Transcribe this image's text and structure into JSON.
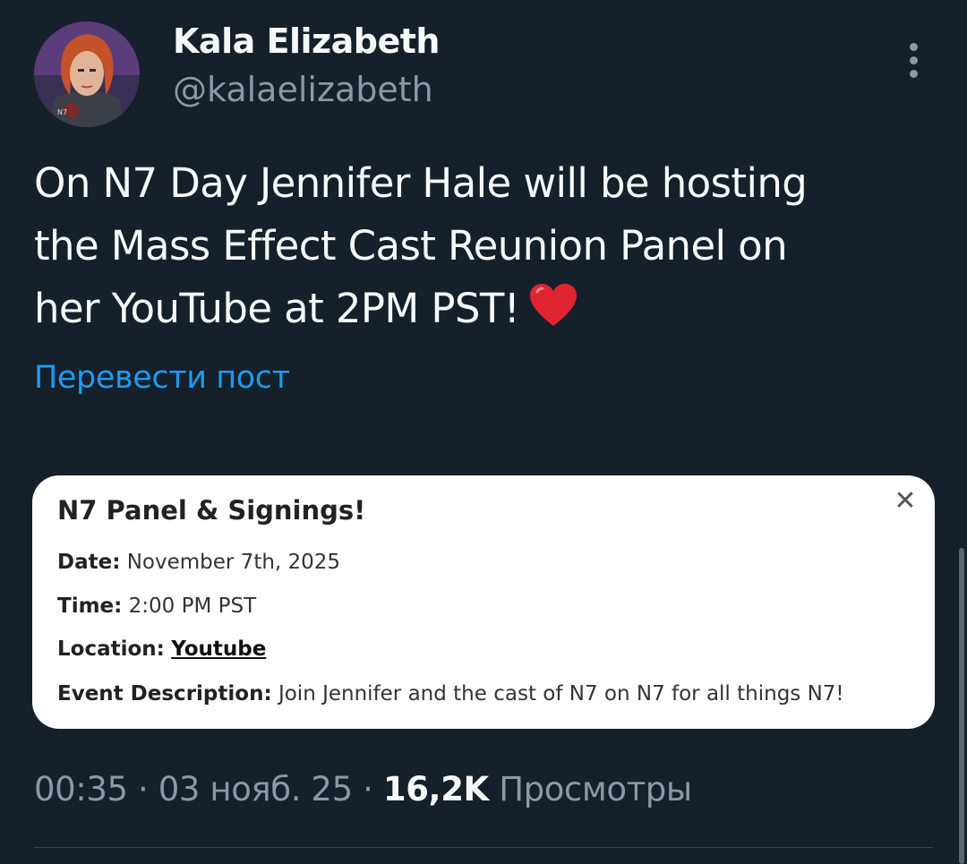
{
  "author": {
    "display_name": "Kala Elizabeth",
    "handle": "@kalaelizabeth",
    "avatar_icon": "avatar-icon"
  },
  "tweet": {
    "lines": [
      "On N7 Day Jennifer Hale will be hosting",
      "the Mass Effect Cast Reunion Panel on",
      "her YouTube at 2PM PST!"
    ],
    "emoji": "heart-icon",
    "translate_label": "Перевести пост"
  },
  "card": {
    "title": "N7 Panel & Signings!",
    "close_icon": "close-icon",
    "rows": {
      "date_label": "Date:",
      "date_value": "November 7th, 2025",
      "time_label": "Time:",
      "time_value": "2:00 PM PST",
      "location_label": "Location:",
      "location_value": "Youtube",
      "description_label": "Event Description:",
      "description_value": "Join Jennifer and the cast of N7 on N7 for all things N7!"
    }
  },
  "meta": {
    "time": "00:35",
    "separator": "·",
    "date": "03 нояб. 25",
    "views_count": "16,2K",
    "views_label": "Просмотры"
  },
  "colors": {
    "background": "#15202b",
    "text_primary": "#f7f9f9",
    "text_secondary": "#8b98a5",
    "link": "#1d9bf0",
    "heart": "#e0242f"
  }
}
